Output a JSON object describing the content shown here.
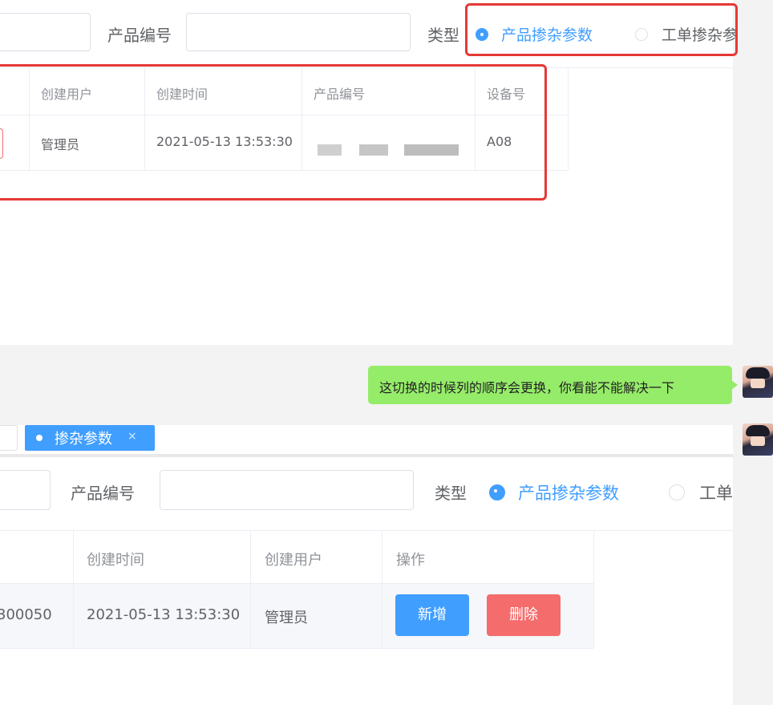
{
  "top": {
    "filter": {
      "product_no_label": "产品编号",
      "type_label": "类型",
      "radio_selected": "产品掺杂参数",
      "radio_other": "工单掺杂参"
    },
    "table": {
      "headers": [
        "创建用户",
        "创建时间",
        "产品编号",
        "设备号"
      ],
      "row": {
        "user": "管理员",
        "time": "2021-05-13 13:53:30",
        "device": "A08"
      }
    }
  },
  "chat": {
    "message": "这切换的时候列的顺序会更换，你看能不能解决一下",
    "bubble_color": "#95ec69"
  },
  "bottom": {
    "tag_label": "掺杂参数",
    "tag_close": "×",
    "filter": {
      "product_no_label": "产品编号",
      "type_label": "类型",
      "radio_selected": "产品掺杂参数",
      "radio_other": "工单"
    },
    "table": {
      "headers": [
        "创建时间",
        "创建用户",
        "操作"
      ],
      "row": {
        "product_no_partial": "300050",
        "time": "2021-05-13 13:53:30",
        "user": "管理员"
      },
      "add_button": "新增",
      "delete_button": "删除"
    }
  },
  "colors": {
    "primary": "#409eff",
    "danger": "#f56c6c",
    "highlight": "#e53935"
  }
}
